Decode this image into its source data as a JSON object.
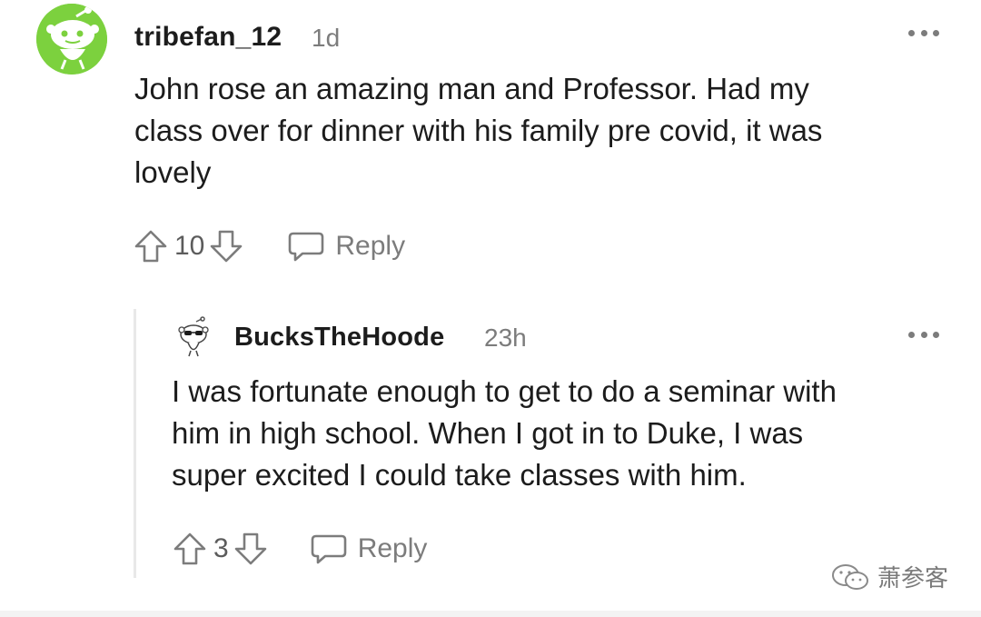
{
  "top_comment": {
    "username": "tribefan_12",
    "timestamp": "1d",
    "body": [
      "John rose an amazing man and Professor. Had my",
      "class over for dinner with his family pre covid, it was",
      "lovely"
    ],
    "votes": "10",
    "reply_label": "Reply",
    "avatar_color": "#7cd13e"
  },
  "reply_comment": {
    "username": "BucksTheHoode",
    "timestamp": "23h",
    "body": [
      "I was fortunate enough to get to do a seminar with",
      "him in high school. When I got in to Duke, I was",
      "super excited I could take classes with him."
    ],
    "votes": "3",
    "reply_label": "Reply"
  },
  "watermark": {
    "label": "萧参客",
    "icon": "wechat-icon"
  },
  "colors": {
    "text": "#1c1c1c",
    "meta": "#7c7c7c",
    "thread_line": "#e8e8e8"
  }
}
